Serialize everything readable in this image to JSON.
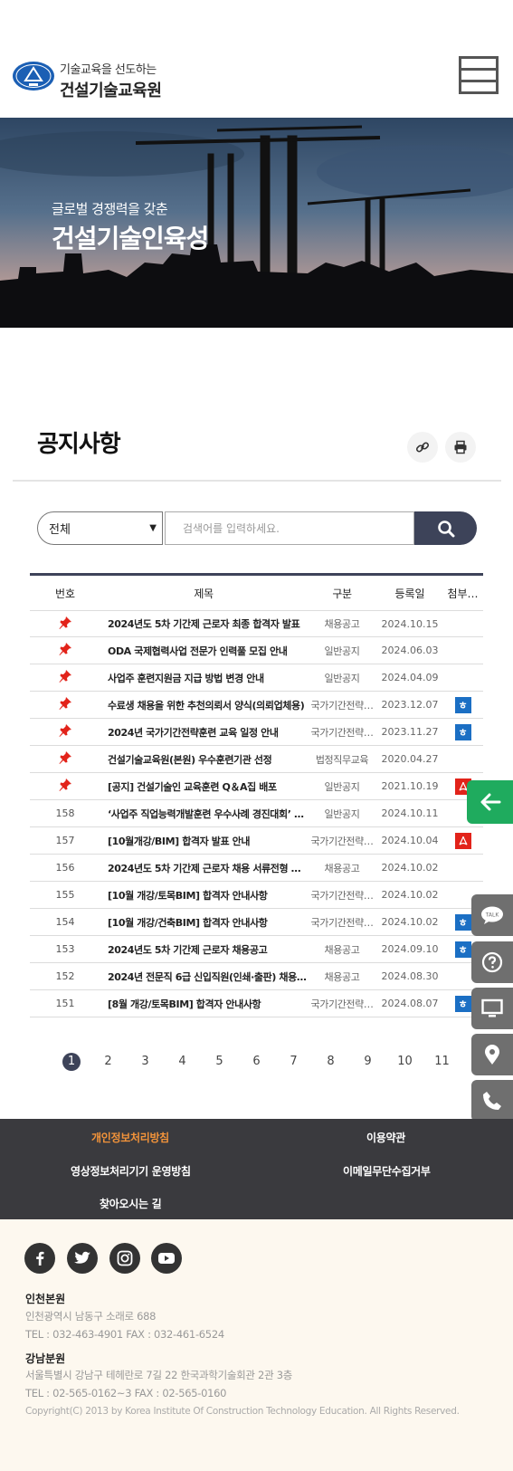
{
  "header": {
    "logo_badge": "건설교육 KICTE",
    "logo_sub": "기술교육을 선도하는",
    "logo_main": "건설기술교육원",
    "menu_icon": "hamburger-icon"
  },
  "hero": {
    "subtitle": "글로벌 경쟁력을 갖춘",
    "title": "건설기술인육성"
  },
  "page": {
    "title": "공지사항",
    "link_icon": "link-icon",
    "print_icon": "print-icon"
  },
  "search": {
    "select_value": "전체",
    "placeholder": "검색어를 입력하세요.",
    "button_icon": "search-icon"
  },
  "board": {
    "headers": {
      "no": "번호",
      "title": "제목",
      "category": "구분",
      "date": "등록일",
      "file": "첨부…"
    },
    "rows": [
      {
        "no": "notice",
        "title": "2024년도 5차 기간제 근로자 최종 합격자 발표",
        "category": "채용공고",
        "date": "2024.10.15",
        "file": ""
      },
      {
        "no": "notice",
        "title": "ODA 국제협력사업 전문가 인력풀 모집 안내",
        "category": "일반공지",
        "date": "2024.06.03",
        "file": ""
      },
      {
        "no": "notice",
        "title": "사업주 훈련지원금 지급 방법 변경 안내",
        "category": "일반공지",
        "date": "2024.04.09",
        "file": ""
      },
      {
        "no": "notice",
        "title": "수료생 채용을 위한 추천의뢰서 양식(의뢰업체용)",
        "category": "국가기간전략…",
        "date": "2023.12.07",
        "file": "hwp"
      },
      {
        "no": "notice",
        "title": "2024년 국가기간전략훈련 교육 일정 안내",
        "category": "국가기간전략…",
        "date": "2023.11.27",
        "file": "hwp"
      },
      {
        "no": "notice",
        "title": "건설기술교육원(본원) 우수훈련기관 선정",
        "category": "법정직무교육",
        "date": "2020.04.27",
        "file": ""
      },
      {
        "no": "notice",
        "title": "[공지] 건설기술인 교육훈련 Q＆A집 배포",
        "category": "일반공지",
        "date": "2021.10.19",
        "file": "pdf"
      },
      {
        "no": "158",
        "title": "‘사업주 직업능력개발훈련 우수사례 경진대회’ …",
        "category": "일반공지",
        "date": "2024.10.11",
        "file": ""
      },
      {
        "no": "157",
        "title": "[10월개강/BIM] 합격자 발표 안내",
        "category": "국가기간전략…",
        "date": "2024.10.04",
        "file": "pdf"
      },
      {
        "no": "156",
        "title": "2024년도 5차 기간제 근로자 채용 서류전형 합…",
        "category": "채용공고",
        "date": "2024.10.02",
        "file": ""
      },
      {
        "no": "155",
        "title": "[10월 개강/토목BIM] 합격자 안내사항",
        "category": "국가기간전략…",
        "date": "2024.10.02",
        "file": ""
      },
      {
        "no": "154",
        "title": "[10월 개강/건축BIM] 합격자 안내사항",
        "category": "국가기간전략…",
        "date": "2024.10.02",
        "file": "hwp"
      },
      {
        "no": "153",
        "title": "2024년도 5차 기간제 근로자 채용공고",
        "category": "채용공고",
        "date": "2024.09.10",
        "file": "hwp"
      },
      {
        "no": "152",
        "title": "2024년 전문직 6급 신입직원(인쇄·출판) 채용 …",
        "category": "채용공고",
        "date": "2024.08.30",
        "file": ""
      },
      {
        "no": "151",
        "title": "[8월 개강/토목BIM] 합격자 안내사항",
        "category": "국가기간전략…",
        "date": "2024.08.07",
        "file": "hwp"
      }
    ]
  },
  "pagination": {
    "current": "1",
    "pages": [
      "2",
      "3",
      "4",
      "5",
      "6",
      "7",
      "8",
      "9",
      "10",
      "11"
    ]
  },
  "quick_menu": {
    "back_icon": "arrow-left-icon",
    "talk_label": "TALK",
    "items": [
      "talk-icon",
      "help-icon",
      "monitor-icon",
      "location-icon",
      "phone-icon"
    ]
  },
  "footer": {
    "links": [
      "개인정보처리방침",
      "이용약관",
      "영상정보처리기기 운영방침",
      "이메일무단수집거부",
      "찾아오시는 길"
    ],
    "sns": [
      "facebook-icon",
      "twitter-icon",
      "instagram-icon",
      "youtube-icon"
    ],
    "branch1_title": "인천본원",
    "branch1_addr": "인천광역시 남동구 소래로 688",
    "branch1_tel": "TEL : 032-463-4901   FAX : 032-461-6524",
    "branch2_title": "강남분원",
    "branch2_addr": "서울특별시 강남구 테헤란로 7길 22 한국과학기술회관 2관 3층",
    "branch2_tel": "TEL : 02-565-0162~3   FAX : 02-565-0160",
    "copyright": "Copyright(C) 2013 by Korea Institute Of Construction Technology Education. All Rights Reserved."
  },
  "colors": {
    "primary": "#3d4359",
    "accent_green": "#1fab5e",
    "footer_dark": "#3a3a3e",
    "highlight": "#f2933a",
    "notice_red": "#e2231a"
  }
}
